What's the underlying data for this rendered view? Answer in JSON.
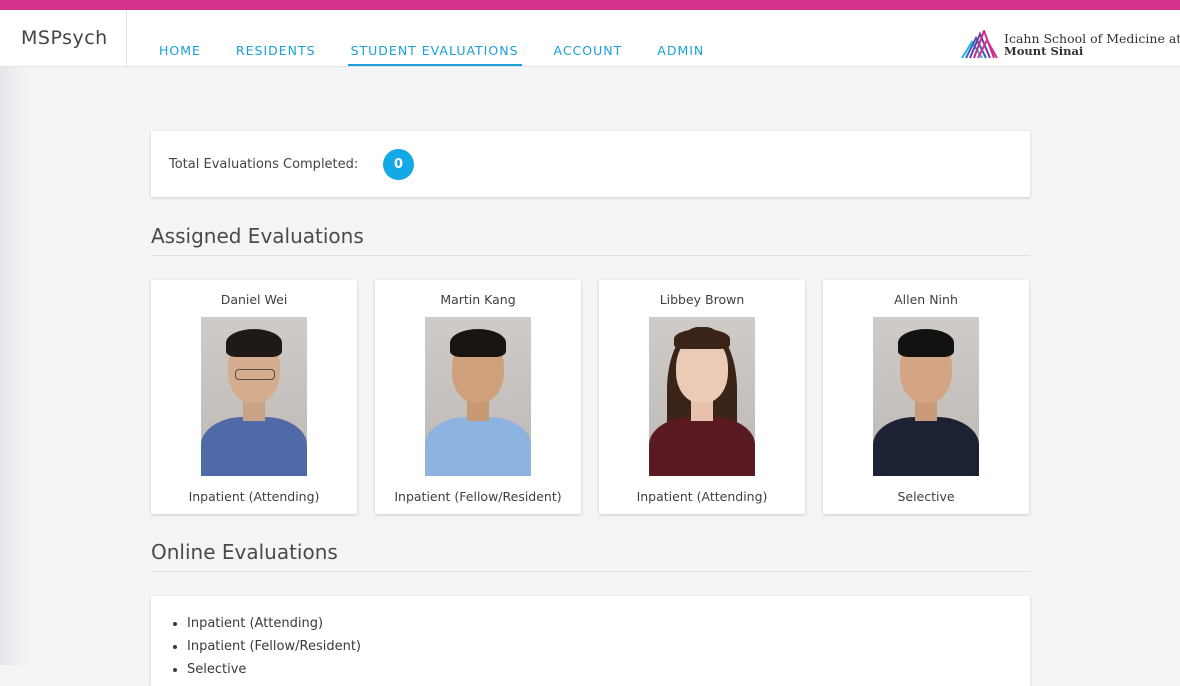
{
  "app": {
    "brand": "MSPsych"
  },
  "nav": {
    "items": [
      {
        "label": "HOME"
      },
      {
        "label": "RESIDENTS"
      },
      {
        "label": "STUDENT EVALUATIONS"
      },
      {
        "label": "ACCOUNT"
      },
      {
        "label": "ADMIN"
      }
    ],
    "active": "STUDENT EVALUATIONS"
  },
  "logo": {
    "line1": "Icahn School of Medicine at",
    "line2": "Mount Sinai"
  },
  "summary": {
    "label": "Total Evaluations Completed:",
    "count": "0"
  },
  "assigned": {
    "title": "Assigned Evaluations",
    "cards": [
      {
        "name": "Daniel Wei",
        "type": "Inpatient (Attending)"
      },
      {
        "name": "Martin Kang",
        "type": "Inpatient (Fellow/Resident)"
      },
      {
        "name": "Libbey Brown",
        "type": "Inpatient (Attending)"
      },
      {
        "name": "Allen Ninh",
        "type": "Selective"
      }
    ]
  },
  "online": {
    "title": "Online Evaluations",
    "items": [
      "Inpatient (Attending)",
      "Inpatient (Fellow/Resident)",
      "Selective"
    ]
  },
  "colors": {
    "accent_bar": "#d6318f",
    "link": "#1a9fd9",
    "badge": "#13a8e6"
  }
}
